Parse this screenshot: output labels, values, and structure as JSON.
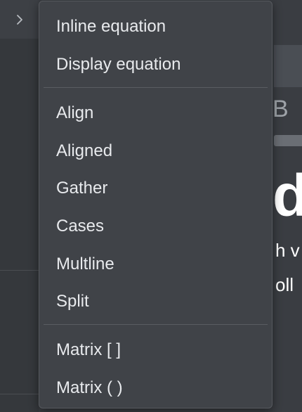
{
  "sidebar": {
    "toggle_icon": "chevron-right-icon"
  },
  "menu": {
    "groups": [
      {
        "items": [
          {
            "label": "Inline equation"
          },
          {
            "label": "Display equation"
          }
        ]
      },
      {
        "items": [
          {
            "label": "Align"
          },
          {
            "label": "Aligned"
          },
          {
            "label": "Gather"
          },
          {
            "label": "Cases"
          },
          {
            "label": "Multline"
          },
          {
            "label": "Split"
          }
        ]
      },
      {
        "items": [
          {
            "label": "Matrix [ ]"
          },
          {
            "label": "Matrix ( )"
          }
        ]
      }
    ]
  },
  "background_doc": {
    "heading_fragment": "B",
    "title_fragment": "d",
    "line1_fragment": "h v",
    "line2_fragment": "oll"
  },
  "colors": {
    "menu_bg": "#404348",
    "page_bg": "#3a3d42",
    "text": "#e8eaed",
    "separator": "#5a5d62"
  }
}
